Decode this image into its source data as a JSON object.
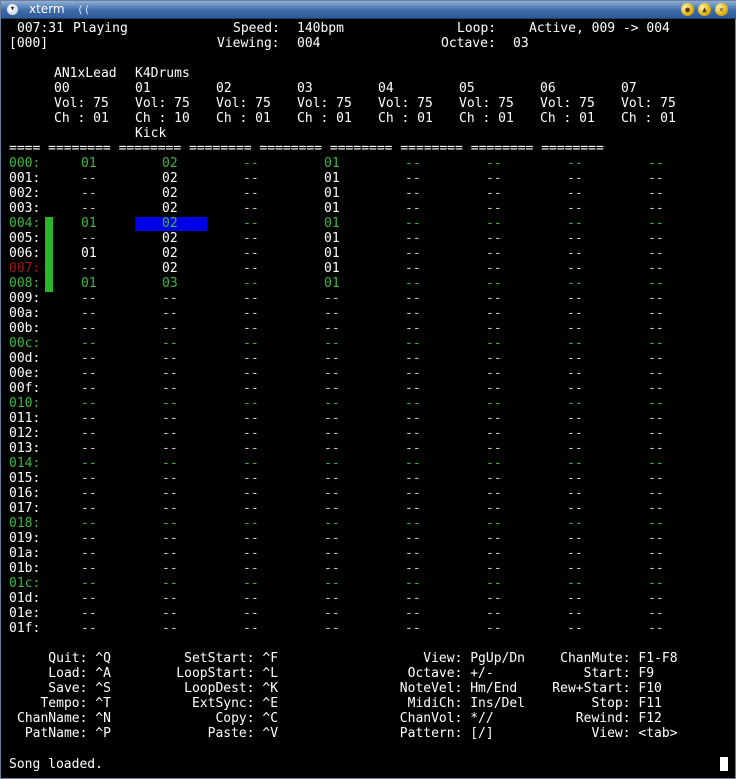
{
  "window": {
    "title": "xterm"
  },
  "status": {
    "position": "007:31",
    "state": "Playing",
    "speed_label": "Speed:",
    "speed": "140bpm",
    "loop_label": "Loop:",
    "loop": "Active, 009 -> 004",
    "pattern": "[000]",
    "viewing_label": "Viewing:",
    "viewing": "004",
    "octave_label": "Octave:",
    "octave": "03"
  },
  "tracks": [
    {
      "num": "00",
      "name": "AN1xLead",
      "vol": "Vol: 75",
      "ch": "Ch : 01",
      "extra": ""
    },
    {
      "num": "01",
      "name": "K4Drums",
      "vol": "Vol: 75",
      "ch": "Ch : 10",
      "extra": "Kick"
    },
    {
      "num": "02",
      "name": "",
      "vol": "Vol: 75",
      "ch": "Ch : 01",
      "extra": ""
    },
    {
      "num": "03",
      "name": "",
      "vol": "Vol: 75",
      "ch": "Ch : 01",
      "extra": ""
    },
    {
      "num": "04",
      "name": "",
      "vol": "Vol: 75",
      "ch": "Ch : 01",
      "extra": ""
    },
    {
      "num": "05",
      "name": "",
      "vol": "Vol: 75",
      "ch": "Ch : 01",
      "extra": ""
    },
    {
      "num": "06",
      "name": "",
      "vol": "Vol: 75",
      "ch": "Ch : 01",
      "extra": ""
    },
    {
      "num": "07",
      "name": "",
      "vol": "Vol: 75",
      "ch": "Ch : 01",
      "extra": ""
    }
  ],
  "separator_row": "==== ======== ======== ======== ======== ======== ======== ======== ========",
  "rows": [
    {
      "label": "000:",
      "cells": [
        "01",
        "02",
        "--",
        "01",
        "--",
        "--",
        "--",
        "--"
      ]
    },
    {
      "label": "001:",
      "cells": [
        "--",
        "02",
        "--",
        "01",
        "--",
        "--",
        "--",
        "--"
      ]
    },
    {
      "label": "002:",
      "cells": [
        "--",
        "02",
        "--",
        "01",
        "--",
        "--",
        "--",
        "--"
      ]
    },
    {
      "label": "003:",
      "cells": [
        "--",
        "02",
        "--",
        "01",
        "--",
        "--",
        "--",
        "--"
      ]
    },
    {
      "label": "004:",
      "cells": [
        "01",
        "02",
        "--",
        "01",
        "--",
        "--",
        "--",
        "--"
      ]
    },
    {
      "label": "005:",
      "cells": [
        "--",
        "02",
        "--",
        "01",
        "--",
        "--",
        "--",
        "--"
      ]
    },
    {
      "label": "006:",
      "cells": [
        "01",
        "02",
        "--",
        "01",
        "--",
        "--",
        "--",
        "--"
      ]
    },
    {
      "label": "007:",
      "cells": [
        "--",
        "02",
        "--",
        "01",
        "--",
        "--",
        "--",
        "--"
      ]
    },
    {
      "label": "008:",
      "cells": [
        "01",
        "03",
        "--",
        "01",
        "--",
        "--",
        "--",
        "--"
      ]
    },
    {
      "label": "009:",
      "cells": [
        "--",
        "--",
        "--",
        "--",
        "--",
        "--",
        "--",
        "--"
      ]
    },
    {
      "label": "00a:",
      "cells": [
        "--",
        "--",
        "--",
        "--",
        "--",
        "--",
        "--",
        "--"
      ]
    },
    {
      "label": "00b:",
      "cells": [
        "--",
        "--",
        "--",
        "--",
        "--",
        "--",
        "--",
        "--"
      ]
    },
    {
      "label": "00c:",
      "cells": [
        "--",
        "--",
        "--",
        "--",
        "--",
        "--",
        "--",
        "--"
      ]
    },
    {
      "label": "00d:",
      "cells": [
        "--",
        "--",
        "--",
        "--",
        "--",
        "--",
        "--",
        "--"
      ]
    },
    {
      "label": "00e:",
      "cells": [
        "--",
        "--",
        "--",
        "--",
        "--",
        "--",
        "--",
        "--"
      ]
    },
    {
      "label": "00f:",
      "cells": [
        "--",
        "--",
        "--",
        "--",
        "--",
        "--",
        "--",
        "--"
      ]
    },
    {
      "label": "010:",
      "cells": [
        "--",
        "--",
        "--",
        "--",
        "--",
        "--",
        "--",
        "--"
      ]
    },
    {
      "label": "011:",
      "cells": [
        "--",
        "--",
        "--",
        "--",
        "--",
        "--",
        "--",
        "--"
      ]
    },
    {
      "label": "012:",
      "cells": [
        "--",
        "--",
        "--",
        "--",
        "--",
        "--",
        "--",
        "--"
      ]
    },
    {
      "label": "013:",
      "cells": [
        "--",
        "--",
        "--",
        "--",
        "--",
        "--",
        "--",
        "--"
      ]
    },
    {
      "label": "014:",
      "cells": [
        "--",
        "--",
        "--",
        "--",
        "--",
        "--",
        "--",
        "--"
      ]
    },
    {
      "label": "015:",
      "cells": [
        "--",
        "--",
        "--",
        "--",
        "--",
        "--",
        "--",
        "--"
      ]
    },
    {
      "label": "016:",
      "cells": [
        "--",
        "--",
        "--",
        "--",
        "--",
        "--",
        "--",
        "--"
      ]
    },
    {
      "label": "017:",
      "cells": [
        "--",
        "--",
        "--",
        "--",
        "--",
        "--",
        "--",
        "--"
      ]
    },
    {
      "label": "018:",
      "cells": [
        "--",
        "--",
        "--",
        "--",
        "--",
        "--",
        "--",
        "--"
      ]
    },
    {
      "label": "019:",
      "cells": [
        "--",
        "--",
        "--",
        "--",
        "--",
        "--",
        "--",
        "--"
      ]
    },
    {
      "label": "01a:",
      "cells": [
        "--",
        "--",
        "--",
        "--",
        "--",
        "--",
        "--",
        "--"
      ]
    },
    {
      "label": "01b:",
      "cells": [
        "--",
        "--",
        "--",
        "--",
        "--",
        "--",
        "--",
        "--"
      ]
    },
    {
      "label": "01c:",
      "cells": [
        "--",
        "--",
        "--",
        "--",
        "--",
        "--",
        "--",
        "--"
      ]
    },
    {
      "label": "01d:",
      "cells": [
        "--",
        "--",
        "--",
        "--",
        "--",
        "--",
        "--",
        "--"
      ]
    },
    {
      "label": "01e:",
      "cells": [
        "--",
        "--",
        "--",
        "--",
        "--",
        "--",
        "--",
        "--"
      ]
    },
    {
      "label": "01f:",
      "cells": [
        "--",
        "--",
        "--",
        "--",
        "--",
        "--",
        "--",
        "--"
      ]
    }
  ],
  "help": [
    [
      "    Quit: ^Q",
      "     SetStart: ^F",
      "          View: PgUp/Dn",
      "     ChanMute: F1-F8"
    ],
    [
      "    Load: ^A",
      "    LoopStart: ^L",
      "        Octave: +/-",
      "        Start: F9"
    ],
    [
      "    Save: ^S",
      "     LoopDest: ^K",
      "       NoteVel: Hm/End",
      "    Rew+Start: F10"
    ],
    [
      "   Tempo: ^T",
      "      ExtSync: ^E",
      "        MidiCh: Ins/Del",
      "         Stop: F11"
    ],
    [
      "ChanName: ^N",
      "         Copy: ^C",
      "       ChanVol: *//",
      "       Rewind: F12"
    ],
    [
      " PatName: ^P",
      "        Paste: ^V",
      "       Pattern: [/]",
      "         View: <tab>"
    ]
  ],
  "message": "Song loaded.",
  "colors": {
    "normal": "#ffffff",
    "beat": "#3cb83c",
    "playhead": "#a01818",
    "selection": "#0000e8",
    "loop_marker": "#2ab62a"
  },
  "icons": [
    "window-menu-icon",
    "minimize-icon",
    "maximize-icon",
    "close-icon"
  ]
}
